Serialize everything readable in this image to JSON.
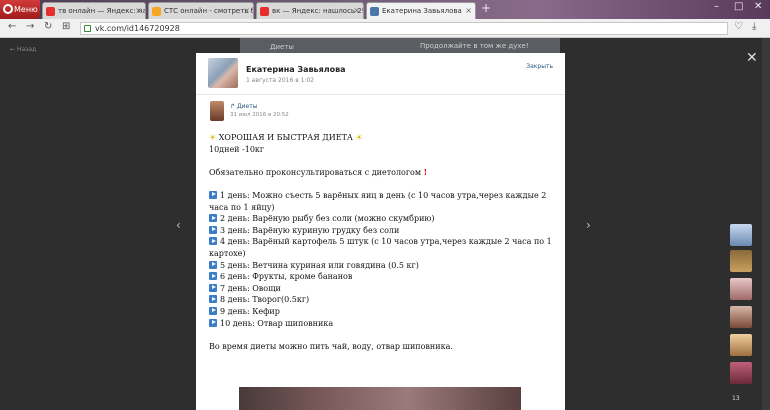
{
  "browser": {
    "menu_label": "Меню",
    "tabs": [
      {
        "label": "тв онлайн — Яндекс: наш",
        "favicon": "yandex-icon",
        "color": "#e62e2e"
      },
      {
        "label": "СТС онлайн - смотреть б",
        "favicon": "sts-icon",
        "color": "#f5a623"
      },
      {
        "label": "вк — Яндекс: нашлось 29",
        "favicon": "yandex-icon",
        "color": "#e62e2e"
      },
      {
        "label": "Екатерина Завьялова",
        "favicon": "vk-icon",
        "color": "#4a76a8"
      }
    ],
    "address": "vk.com/id146720928"
  },
  "page": {
    "back_link": "Назад",
    "under_left": "Диеты",
    "under_right": "Продолжайте в том же духе!"
  },
  "post": {
    "author": "Екатерина Завьялова",
    "date": "1 августа 2016 в 1:02",
    "close_label": "Закрыть",
    "repost": {
      "source": "Диеты",
      "date": "31 июл 2016 в 20:52"
    },
    "lines": {
      "title": "ХОРОШАЯ И БЫСТРАЯ ДИЕТА",
      "subtitle": "10дней -10кг",
      "consult": "Обязательно проконсультироваться с диетологом",
      "d1a": "1 день: Можно съесть 5 варёных яиц в день (с 10 часов утра,через каждые 2",
      "d1b": "часа по 1 яйцу)",
      "d2": "2 день: Варёную рыбу без соли (можно скумбрию)",
      "d3": "3 день: Варёную куриную грудку без соли",
      "d4a": "4 день: Варёный картофель 5 штук (с 10 часов утра,через каждые 2 часа по 1",
      "d4b": "картохе)",
      "d5": "5 день: Ветчина куриная или говядина (0.5 кг)",
      "d6": "6 день: Фрукты, кроме бананов",
      "d7": "7 день: Овощи",
      "d8": "8 день: Творог(0.5кг)",
      "d9": "9 день: Кефир",
      "d10": "10 день: Отвар шиповника",
      "footer": "Во время диеты можно пить чай, воду, отвар шиповника."
    }
  },
  "sidebar": {
    "count": "13"
  }
}
